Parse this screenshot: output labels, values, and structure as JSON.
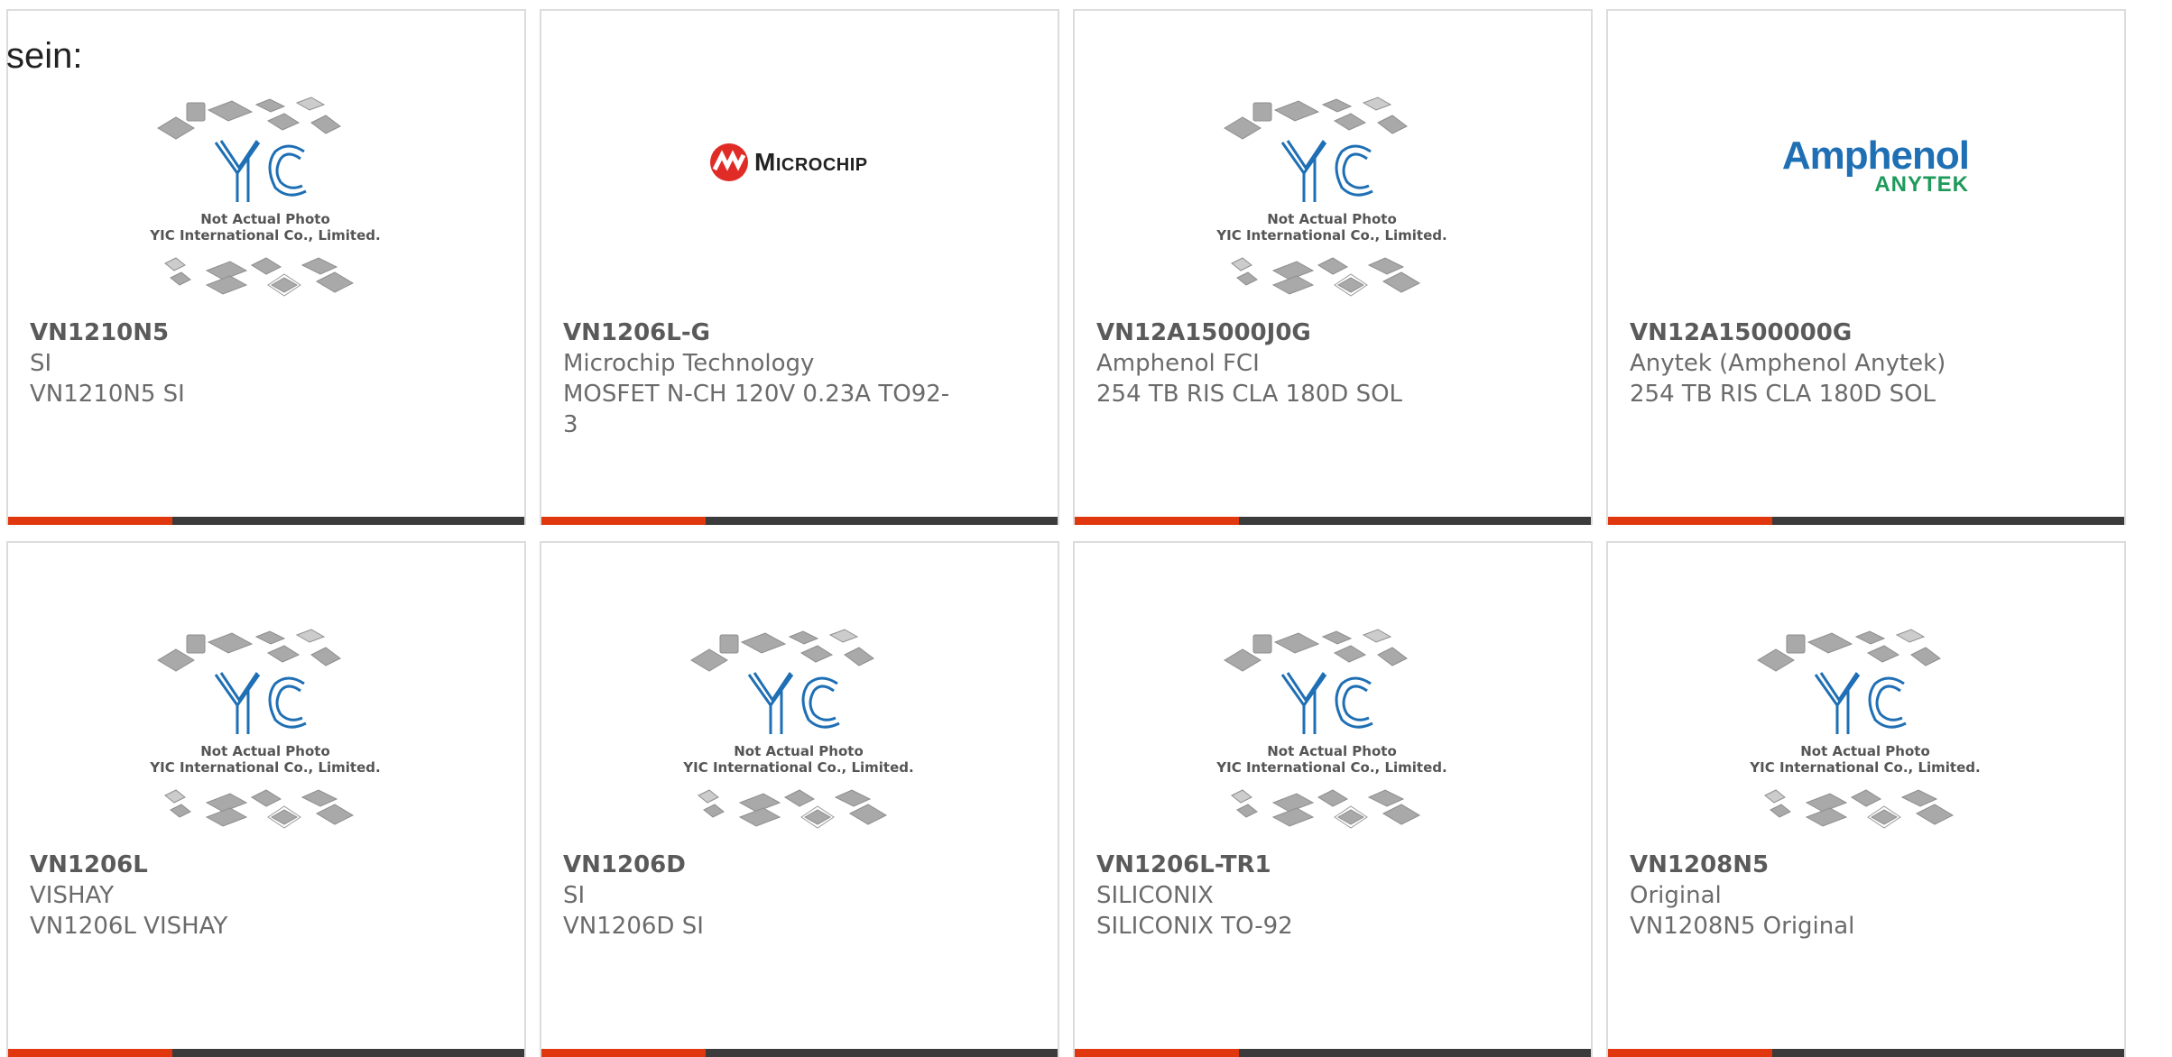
{
  "page": {
    "lead_text": "sein:"
  },
  "placeholder": {
    "line1": "Not Actual Photo",
    "line2": "YIC International Co., Limited."
  },
  "products": [
    {
      "part": "VN1210N5",
      "maker": "SI",
      "desc": "VN1210N5 SI",
      "image": "placeholder"
    },
    {
      "part": "VN1206L-G",
      "maker": "Microchip Technology",
      "desc": "MOSFET N-CH 120V 0.23A TO92-3",
      "image": "microchip-logo",
      "logo_text": "Microchip"
    },
    {
      "part": "VN12A15000J0G",
      "maker": "Amphenol FCI",
      "desc": "254 TB RIS CLA 180D SOL",
      "image": "placeholder"
    },
    {
      "part": "VN12A1500000G",
      "maker": "Anytek (Amphenol Anytek)",
      "desc": "254 TB RIS CLA 180D SOL",
      "image": "amphenol-logo",
      "logo_text": "Amphenol",
      "logo_sub": "ANYTEK"
    },
    {
      "part": "VN1206L",
      "maker": "VISHAY",
      "desc": "VN1206L VISHAY",
      "image": "placeholder"
    },
    {
      "part": "VN1206D",
      "maker": "SI",
      "desc": "VN1206D SI",
      "image": "placeholder"
    },
    {
      "part": "VN1206L-TR1",
      "maker": "SILICONIX",
      "desc": "SILICONIX TO-92",
      "image": "placeholder"
    },
    {
      "part": "VN1208N5",
      "maker": "Original",
      "desc": "VN1208N5 Original",
      "image": "placeholder"
    }
  ],
  "colors": {
    "accent": "#e0370f",
    "bar": "#3b3b3b",
    "yic_blue": "#1f6fb4",
    "microchip_red": "#e02b27",
    "anytek_green": "#1e9a5b"
  }
}
